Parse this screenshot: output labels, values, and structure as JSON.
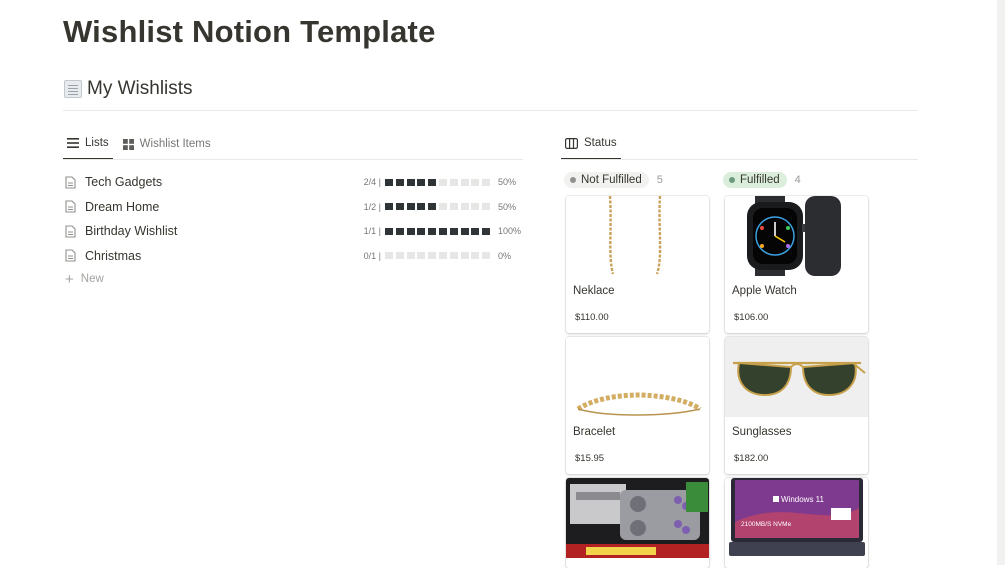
{
  "page": {
    "title": "Wishlist Notion Template"
  },
  "section": {
    "title": "My Wishlists",
    "icon": "page-facing-up-icon"
  },
  "left_view": {
    "tabs": [
      {
        "label": "Lists",
        "icon": "list-icon",
        "active": true
      },
      {
        "label": "Wishlist Items",
        "icon": "gallery-icon",
        "active": false
      }
    ],
    "rows": [
      {
        "name": "Tech Gadgets",
        "fraction": "2/4 |",
        "progress": 0.5,
        "percent": "50%"
      },
      {
        "name": "Dream Home",
        "fraction": "1/2 |",
        "progress": 0.5,
        "percent": "50%"
      },
      {
        "name": "Birthday Wishlist",
        "fraction": "1/1 |",
        "progress": 1.0,
        "percent": "100%"
      },
      {
        "name": "Christmas",
        "fraction": "0/1 |",
        "progress": 0.0,
        "percent": "0%"
      }
    ],
    "new_label": "New"
  },
  "right_view": {
    "tab": {
      "label": "Status",
      "icon": "board-icon"
    },
    "groups": [
      {
        "label": "Not Fulfilled",
        "count": "5",
        "color": "#91918e",
        "bg": "#f1f1ef",
        "cards": [
          {
            "title": "Neklace",
            "price": "$110.00",
            "image": "necklace-image"
          },
          {
            "title": "Bracelet",
            "price": "$15.95",
            "image": "bracelet-image"
          },
          {
            "title": "",
            "price": "",
            "image": "super-nintendo-image"
          }
        ]
      },
      {
        "label": "Fulfilled",
        "count": "4",
        "color": "#6c9b7d",
        "bg": "#dbeddb",
        "cards": [
          {
            "title": "Apple Watch",
            "price": "$106.00",
            "image": "apple-watch-image"
          },
          {
            "title": "Sunglasses",
            "price": "$182.00",
            "image": "sunglasses-image"
          },
          {
            "title": "",
            "price": "",
            "image": "laptop-image",
            "overlay_text": "Windows 11",
            "overlay_sub": "2100MB/S NVMe"
          }
        ]
      }
    ]
  }
}
